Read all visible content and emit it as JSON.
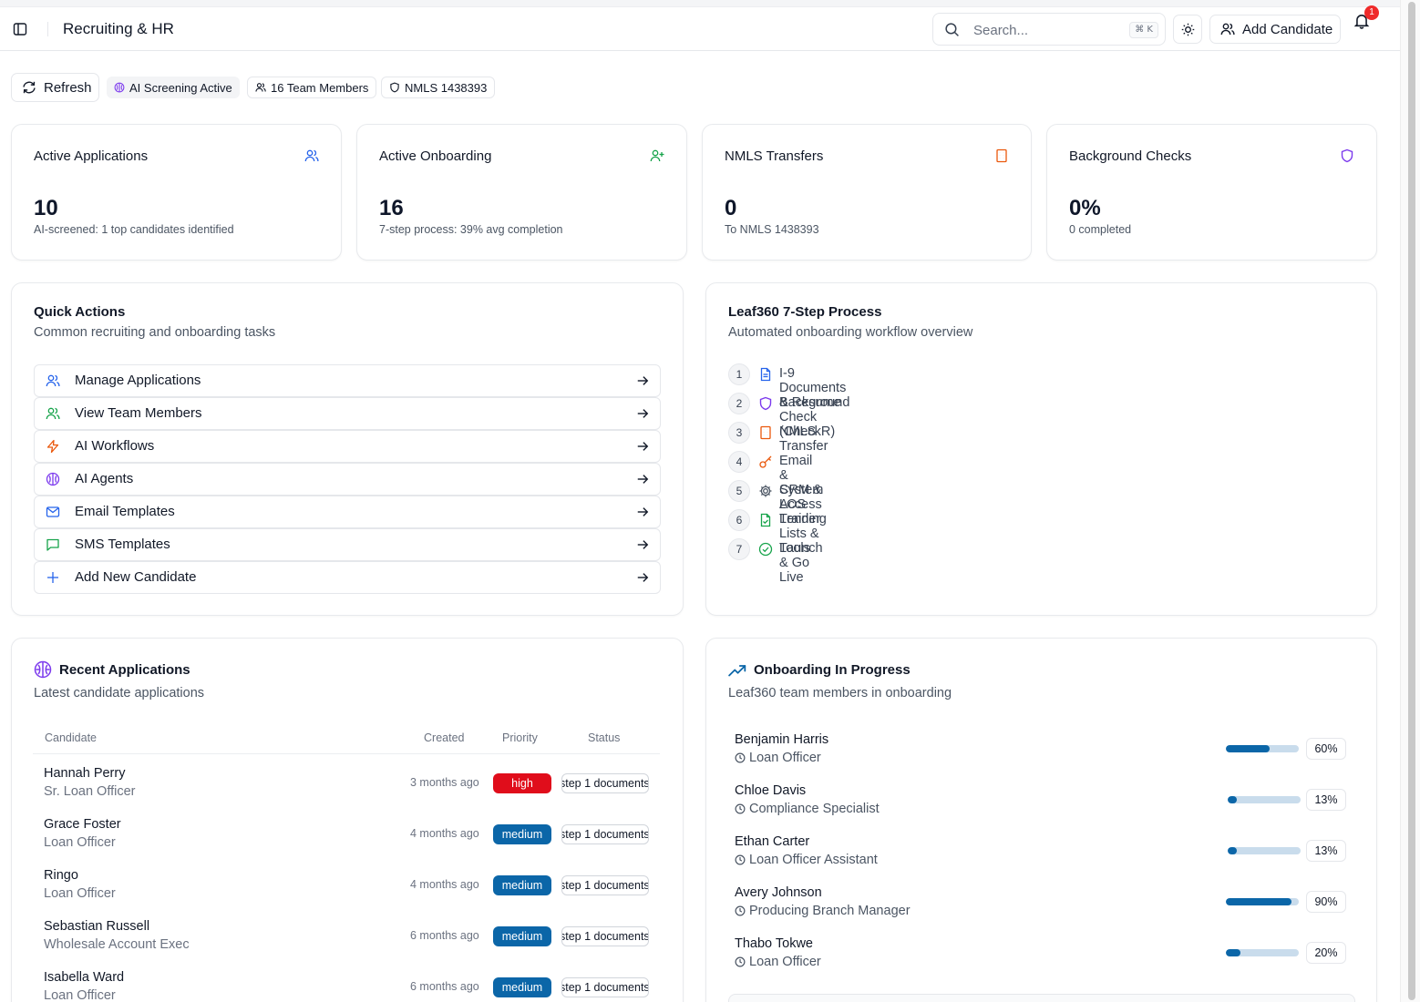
{
  "header": {
    "title": "Recruiting & HR",
    "search_placeholder": "Search...",
    "shortcut": "⌘ K",
    "add_candidate_label": "Add Candidate",
    "notification_count": "1"
  },
  "toolbar": {
    "refresh_label": "Refresh",
    "pills": [
      "AI Screening Active",
      "16 Team Members",
      "NMLS 1438393"
    ]
  },
  "stats": [
    {
      "label": "Active Applications",
      "value": "10",
      "sub": "AI-screened: 1 top candidates identified",
      "icon": "users-icon",
      "color": "#2563eb"
    },
    {
      "label": "Active Onboarding",
      "value": "16",
      "sub": "7-step process: 39% avg completion",
      "icon": "user-plus-icon",
      "color": "#16a34a"
    },
    {
      "label": "NMLS Transfers",
      "value": "0",
      "sub": "To NMLS 1438393",
      "icon": "building-icon",
      "color": "#ea580c"
    },
    {
      "label": "Background Checks",
      "value": "0%",
      "sub": "0 completed",
      "icon": "shield-icon",
      "color": "#7c3aed"
    }
  ],
  "quick_actions": {
    "title": "Quick Actions",
    "description": "Common recruiting and onboarding tasks",
    "items": [
      {
        "label": "Manage Applications",
        "icon": "users-icon",
        "color": "#2563eb"
      },
      {
        "label": "View Team Members",
        "icon": "users-icon",
        "color": "#16a34a"
      },
      {
        "label": "AI Workflows",
        "icon": "lightning-icon",
        "color": "#ea580c"
      },
      {
        "label": "AI Agents",
        "icon": "brain-icon",
        "color": "#7c3aed"
      },
      {
        "label": "Email Templates",
        "icon": "mail-icon",
        "color": "#2563eb"
      },
      {
        "label": "SMS Templates",
        "icon": "message-icon",
        "color": "#16a34a"
      },
      {
        "label": "Add New Candidate",
        "icon": "plus-icon",
        "color": "#2563eb"
      }
    ]
  },
  "process": {
    "title": "Leaf360 7-Step Process",
    "description": "Automated onboarding workflow overview",
    "steps": [
      {
        "num": "1",
        "label": "I-9 Documents & Resume",
        "icon": "document-icon",
        "color": "#2563eb"
      },
      {
        "num": "2",
        "label": "Background Check (CheckR)",
        "icon": "shield-icon",
        "color": "#7c3aed"
      },
      {
        "num": "3",
        "label": "NMLS Transfer",
        "icon": "building-icon",
        "color": "#ea580c"
      },
      {
        "num": "4",
        "label": "Email & System Access",
        "icon": "key-icon",
        "color": "#ea580c"
      },
      {
        "num": "5",
        "label": "CRM & LOS Training",
        "icon": "gear-icon",
        "color": "#4b5563"
      },
      {
        "num": "6",
        "label": "Lender Lists & Tools",
        "icon": "file-check-icon",
        "color": "#16a34a"
      },
      {
        "num": "7",
        "label": "Launch & Go Live",
        "icon": "check-circle-icon",
        "color": "#16a34a"
      }
    ]
  },
  "recent_applications": {
    "title": "Recent Applications",
    "description": "Latest candidate applications",
    "columns": [
      "Candidate",
      "Created",
      "Priority",
      "Status"
    ],
    "rows": [
      {
        "name": "Hannah Perry",
        "role": "Sr. Loan Officer",
        "created": "3 months ago",
        "priority": "high",
        "status": "step 1 documents"
      },
      {
        "name": "Grace Foster",
        "role": "Loan Officer",
        "created": "4 months ago",
        "priority": "medium",
        "status": "step 1 documents"
      },
      {
        "name": "Ringo",
        "role": "Loan Officer",
        "created": "4 months ago",
        "priority": "medium",
        "status": "step 1 documents"
      },
      {
        "name": "Sebastian Russell",
        "role": "Wholesale Account Exec",
        "created": "6 months ago",
        "priority": "medium",
        "status": "step 1 documents"
      },
      {
        "name": "Isabella Ward",
        "role": "Loan Officer",
        "created": "6 months ago",
        "priority": "medium",
        "status": "step 1 documents"
      }
    ]
  },
  "onboarding": {
    "title": "Onboarding In Progress",
    "description": "Leaf360 team members in onboarding",
    "rows": [
      {
        "name": "Benjamin Harris",
        "role": "Loan Officer",
        "progress": 60,
        "label": "60%"
      },
      {
        "name": "Chloe Davis",
        "role": "Compliance Specialist",
        "progress": 13,
        "label": "13%"
      },
      {
        "name": "Ethan Carter",
        "role": "Loan Officer Assistant",
        "progress": 13,
        "label": "13%"
      },
      {
        "name": "Avery Johnson",
        "role": "Producing Branch Manager",
        "progress": 90,
        "label": "90%"
      },
      {
        "name": "Thabo Tokwe",
        "role": "Loan Officer",
        "progress": 20,
        "label": "20%"
      }
    ]
  },
  "colors": {
    "high": "#e00d1b",
    "medium": "#0b66a8",
    "progress_fill": "#0b66a8",
    "progress_track": "#c9dcec"
  }
}
